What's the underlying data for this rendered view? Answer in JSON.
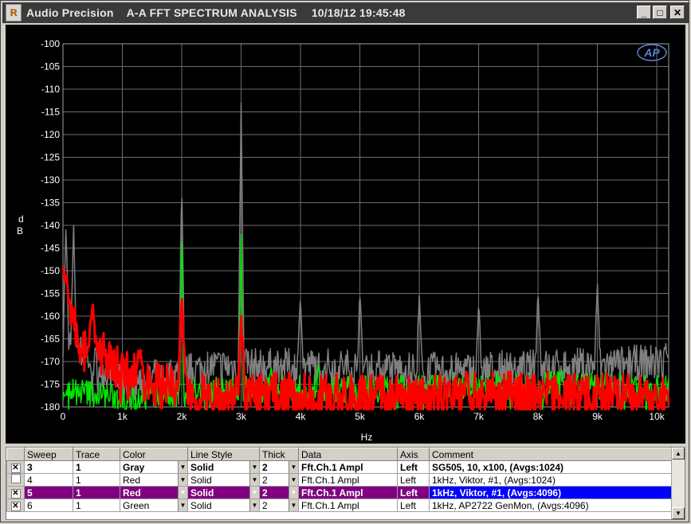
{
  "window": {
    "app_name": "Audio Precision",
    "title": "A-A FFT SPECTRUM ANALYSIS",
    "timestamp": "10/18/12 19:45:48",
    "minimize_icon": "minimize-icon",
    "maximize_icon": "maximize-icon",
    "close_icon": "close-icon"
  },
  "colors": {
    "gray": "#808080",
    "red": "#ff0000",
    "green": "#00e600",
    "background": "#000000",
    "grid": "#6e6e6e"
  },
  "chart_data": {
    "type": "line",
    "title": "",
    "xlabel": "Hz",
    "ylabel": "dB",
    "xlim": [
      0,
      10200
    ],
    "ylim": [
      -180,
      -100
    ],
    "x_ticks": [
      0,
      1000,
      2000,
      3000,
      4000,
      5000,
      6000,
      7000,
      8000,
      9000,
      10000
    ],
    "x_tick_labels": [
      "0",
      "1k",
      "2k",
      "3k",
      "4k",
      "5k",
      "6k",
      "7k",
      "8k",
      "9k",
      "10k"
    ],
    "y_ticks": [
      -100,
      -105,
      -110,
      -115,
      -120,
      -125,
      -130,
      -135,
      -140,
      -145,
      -150,
      -155,
      -160,
      -165,
      -170,
      -175,
      -180
    ],
    "y_tick_labels": [
      "-100",
      "-105",
      "-110",
      "-115",
      "-120",
      "-125",
      "-130",
      "-135",
      "-140",
      "-145",
      "-150",
      "-155",
      "-160",
      "-165",
      "-170",
      "-175",
      "-180"
    ],
    "grid": true,
    "series": [
      {
        "color": "#808080",
        "peaks": [
          [
            50,
            -140
          ],
          [
            180,
            -140
          ],
          [
            2000,
            -130.5
          ],
          [
            3000,
            -113
          ],
          [
            4000,
            -155
          ],
          [
            5000,
            -154
          ],
          [
            6000,
            -155.5
          ],
          [
            7000,
            -157
          ],
          [
            8000,
            -154
          ],
          [
            9000,
            -153
          ],
          [
            10150,
            -166
          ]
        ],
        "floor": [
          [
            0,
            -165
          ],
          [
            1000,
            -175
          ],
          [
            2500,
            -171
          ],
          [
            4500,
            -171
          ],
          [
            6500,
            -172
          ],
          [
            8500,
            -171
          ],
          [
            10200,
            -170
          ]
        ]
      },
      {
        "color": "#00e600",
        "peaks": [
          [
            2000,
            -140
          ],
          [
            3000,
            -142
          ],
          [
            3500,
            -171
          ],
          [
            4300,
            -170
          ],
          [
            5200,
            -172
          ],
          [
            6200,
            -173
          ],
          [
            7100,
            -174
          ],
          [
            8400,
            -172
          ],
          [
            9400,
            -173
          ],
          [
            9900,
            -175
          ]
        ],
        "floor": [
          [
            0,
            -176
          ],
          [
            1000,
            -178
          ],
          [
            3000,
            -176
          ],
          [
            6000,
            -176
          ],
          [
            8000,
            -175
          ],
          [
            10200,
            -176
          ]
        ]
      },
      {
        "color": "#ff0000",
        "peaks": [
          [
            10,
            -149
          ],
          [
            60,
            -151
          ],
          [
            500,
            -157
          ],
          [
            1300,
            -167
          ],
          [
            2000,
            -155
          ],
          [
            3000,
            -160
          ],
          [
            5300,
            -174
          ],
          [
            6800,
            -172
          ],
          [
            8200,
            -174
          ],
          [
            9800,
            -176
          ]
        ],
        "floor": [
          [
            0,
            -158
          ],
          [
            300,
            -164
          ],
          [
            1000,
            -172
          ],
          [
            2000,
            -177
          ],
          [
            3000,
            -177
          ],
          [
            5000,
            -178
          ],
          [
            8000,
            -177
          ],
          [
            10200,
            -178
          ]
        ]
      }
    ]
  },
  "legend": {
    "headers": [
      "Sweep",
      "Trace",
      "Color",
      "Line Style",
      "Thick",
      "Data",
      "Axis",
      "Comment"
    ],
    "rows": [
      {
        "checked": "✕",
        "sweep": "3",
        "trace": "1",
        "color": "Gray",
        "style": "Solid",
        "thick": "2",
        "data": "Fft.Ch.1 Ampl",
        "axis": "Left",
        "comment": "SG505, 10, x100, (Avgs:1024)"
      },
      {
        "checked": "",
        "sweep": "4",
        "trace": "1",
        "color": "Red",
        "style": "Solid",
        "thick": "2",
        "data": "Fft.Ch.1 Ampl",
        "axis": "Left",
        "comment": "1kHz, Viktor, #1, (Avgs:1024)"
      },
      {
        "checked": "✕",
        "sweep": "5",
        "trace": "1",
        "color": "Red",
        "style": "Solid",
        "thick": "2",
        "data": "Fft.Ch.1 Ampl",
        "axis": "Left",
        "comment": "1kHz, Viktor, #1, (Avgs:4096)"
      },
      {
        "checked": "✕",
        "sweep": "6",
        "trace": "1",
        "color": "Green",
        "style": "Solid",
        "thick": "2",
        "data": "Fft.Ch.1 Ampl",
        "axis": "Left",
        "comment": "1kHz, AP2722 GenMon, (Avgs:4096)"
      }
    ]
  },
  "scroll_up_icon": "scroll-up-icon",
  "scroll_down_icon": "scroll-down-icon"
}
